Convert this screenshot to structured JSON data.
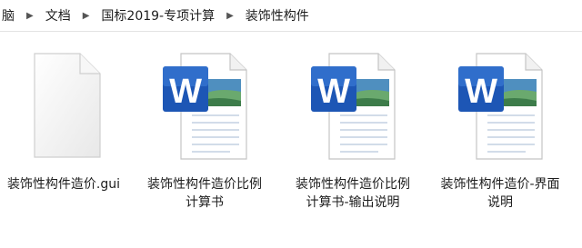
{
  "breadcrumb": {
    "items": [
      "脑",
      "文档",
      "国标2019-专项计算",
      "装饰性构件"
    ]
  },
  "files": [
    {
      "name": "装饰性构件造价.gui",
      "type": "generic",
      "icon": "blank-file-icon"
    },
    {
      "name": "装饰性构件造价比例计算书",
      "type": "word",
      "icon": "word-document-icon"
    },
    {
      "name": "装饰性构件造价比例计算书-输出说明",
      "type": "word",
      "icon": "word-document-icon"
    },
    {
      "name": "装饰性构件造价-界面说明",
      "type": "word",
      "icon": "word-document-icon"
    }
  ],
  "colors": {
    "word_blue": "#1d56b5",
    "word_blue_light": "#3f84dd",
    "page_gray": "#f1f1f1"
  }
}
